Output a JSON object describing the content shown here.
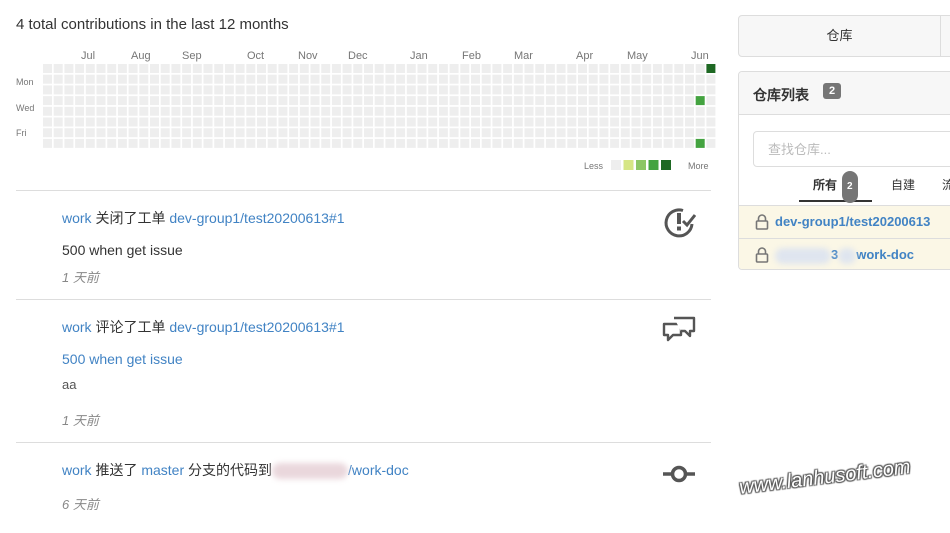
{
  "heatmap": {
    "title": "4 total contributions in the last 12 months",
    "months": [
      "Jul",
      "Aug",
      "Sep",
      "Oct",
      "Nov",
      "Dec",
      "Jan",
      "Feb",
      "Mar",
      "Apr",
      "May",
      "Jun"
    ],
    "days": [
      "Mon",
      "Wed",
      "Fri"
    ],
    "legend_less": "Less",
    "legend_more": "More",
    "colors": [
      "#eeeeee",
      "#d6e685",
      "#8cc665",
      "#44a340",
      "#1e6823"
    ]
  },
  "feed": [
    {
      "actor": "work",
      "action": "关闭了工单",
      "target": "dev-group1/test20200613#1",
      "body": "500 when get issue",
      "time": "1 天前",
      "icon": "issue-closed-icon"
    },
    {
      "actor": "work",
      "action": "评论了工单",
      "target": "dev-group1/test20200613#1",
      "link": "500 when get issue",
      "comment": "aa",
      "time": "1 天前",
      "icon": "comment-discussion-icon"
    },
    {
      "actor": "work",
      "action_pre": "推送了",
      "branch": "master",
      "action_post": "分支的代码到",
      "target_tail": "/work-doc",
      "time": "6 天前",
      "icon": "git-commit-icon"
    }
  ],
  "sidebar": {
    "tab_label": "仓库",
    "panel_title": "仓库列表",
    "repo_count": "2",
    "search_placeholder": "查找仓库...",
    "filters": {
      "all": "所有",
      "all_count": "2",
      "own": "自建",
      "mirror": "流"
    },
    "repos": [
      {
        "name": "dev-group1/test20200613"
      },
      {
        "name": "work-doc"
      }
    ],
    "repo2_hidden_char": "3"
  },
  "watermark": "www.lanhusoft.com"
}
